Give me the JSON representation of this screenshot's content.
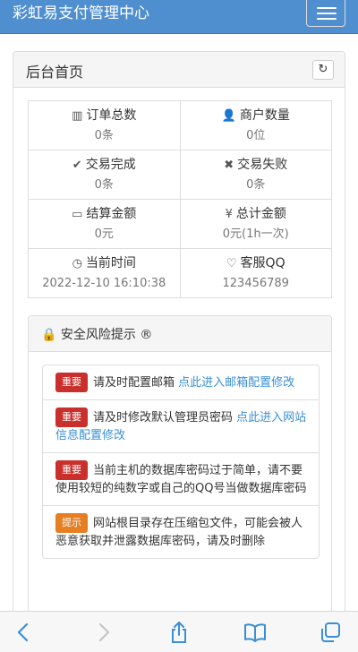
{
  "header": {
    "title": "彩虹易支付管理中心"
  },
  "panel": {
    "title": "后台首页"
  },
  "stats": [
    {
      "label": "订单总数",
      "value": "0条",
      "icon": "bar-chart-icon"
    },
    {
      "label": "商户数量",
      "value": "0位",
      "icon": "user-plus-icon"
    },
    {
      "label": "交易完成",
      "value": "0条",
      "icon": "check-icon"
    },
    {
      "label": "交易失败",
      "value": "0条",
      "icon": "times-icon"
    },
    {
      "label": "结算金额",
      "value": "0元",
      "icon": "money-icon"
    },
    {
      "label": "总计金额",
      "value": "0元(1h一次)",
      "icon": "yen-icon"
    },
    {
      "label": "当前时间",
      "value": "2022-12-10 16:10:38",
      "icon": "clock-icon"
    },
    {
      "label": "客服QQ",
      "value": "123456789",
      "icon": "heart-icon"
    }
  ],
  "risk": {
    "title": "安全风险提示",
    "items": [
      {
        "badge": "重要",
        "text": "请及时配置邮箱 ",
        "link": "点此进入邮箱配置修改"
      },
      {
        "badge": "重要",
        "text": "请及时修改默认管理员密码 ",
        "link": "点此进入网站信息配置修改"
      },
      {
        "badge": "重要",
        "text": "当前主机的数据库密码过于简单，请不要使用较短的纯数字或自己的QQ号当做数据库密码",
        "link": ""
      },
      {
        "badge": "提示",
        "text": "网站根目录存在压缩包文件，可能会被人恶意获取并泄露数据库密码，请及时删除",
        "link": ""
      }
    ]
  },
  "colors": {
    "navbar": "#4f8fd0",
    "danger": "#c9302c",
    "warning": "#e67e22",
    "link": "#3a8fd6"
  }
}
